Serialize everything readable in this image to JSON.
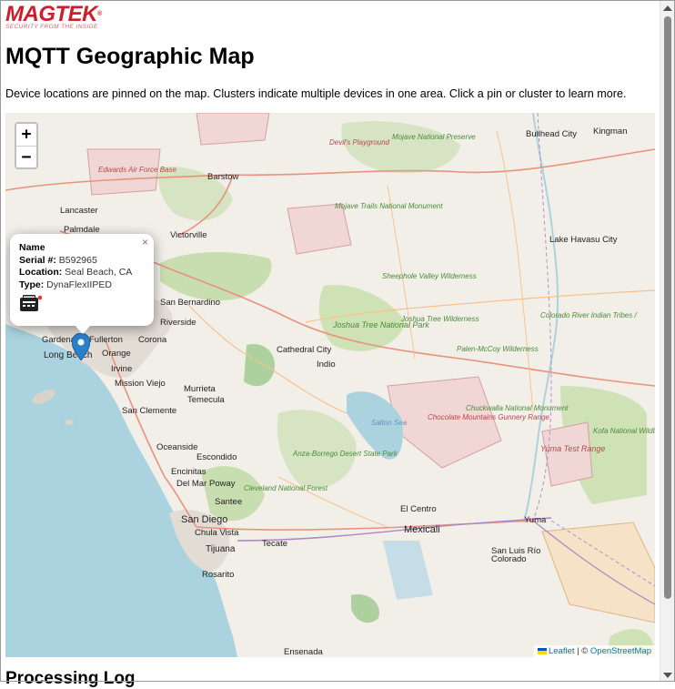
{
  "brand": {
    "name": "MAGTEK",
    "registered_mark": "®",
    "tagline": "SECURITY FROM THE INSIDE",
    "color": "#cc1f2d"
  },
  "page": {
    "title": "MQTT Geographic Map",
    "description": "Device locations are pinned on the map. Clusters indicate multiple devices in one area. Click a pin or cluster to learn more.",
    "next_section_title": "Processing Log"
  },
  "map": {
    "zoom_in_label": "+",
    "zoom_out_label": "−",
    "attribution": {
      "leaflet": "Leaflet",
      "separator": "| ©",
      "osm": "OpenStreetMap"
    },
    "marker_color": "#2a81cb",
    "labels": {
      "bullhead_city": "Bullhead City",
      "kingman": "Kingman",
      "devils_playground": "Devil's Playground",
      "mojave_preserve": "Mojave National Preserve",
      "edwards_afb": "Edwards Air Force Base",
      "barstow": "Barstow",
      "lancaster": "Lancaster",
      "palmdale": "Palmdale",
      "mojave_trails": "Mojave Trails National Monument",
      "victorville": "Victorville",
      "lake_havasu": "Lake Havasu City",
      "sheephole": "Sheephole Valley Wilderness",
      "san_bernardino": "San Bernardino",
      "riverside": "Riverside",
      "corona": "Corona",
      "fullerton": "Fullerton",
      "gardena": "Gardena",
      "long_beach": "Long Beach",
      "orange": "Orange",
      "irvine": "Irvine",
      "joshua_tree_np": "Joshua Tree National Park",
      "joshua_tree_wild": "Joshua Tree Wilderness",
      "cathedral_city": "Cathedral City",
      "indio": "Indio",
      "palen_mccoy": "Palen-McCoy Wilderness",
      "colorado_river": "Colorado River Indian Tribes / ",
      "mission_viejo": "Mission Viejo",
      "murrieta": "Murrieta",
      "temecula": "Temecula",
      "san_clemente": "San Clemente",
      "salton_sea": "Salton Sea",
      "chuckwalla": "Chuckwalla National Monument",
      "chocolate_mountains": "Chocolate Mountains Gunnery Range",
      "kofa": "Kofa National Wildlife Refuge",
      "yuma_test": "Yuma Test Range",
      "oceanside": "Oceanside",
      "escondido": "Escondido",
      "encinitas": "Encinitas",
      "del_mar": "Del Mar",
      "poway": "Poway",
      "anza_borrego": "Anza-Borrego Desert State Park",
      "cleveland_nf": "Cleveland National Forest",
      "santee": "Santee",
      "san_diego": "San Diego",
      "chula_vista": "Chula Vista",
      "el_centro": "El Centro",
      "yuma": "Yuma",
      "mexicali": "Mexicali",
      "tecate": "Tecate",
      "tijuana": "Tijuana",
      "san_luis": "San Luis Río Colorado",
      "rosarito": "Rosarito",
      "ensenada": "Ensenada"
    }
  },
  "popup": {
    "name_label": "Name",
    "serial_label": "Serial #:",
    "serial_value": "B592965",
    "location_label": "Location:",
    "location_value": "Seal Beach, CA",
    "type_label": "Type:",
    "type_value": "DynaFlexIIPED",
    "close_label": "×",
    "status_dot_color": "#e53935",
    "device_icon": "card-reader-icon"
  }
}
